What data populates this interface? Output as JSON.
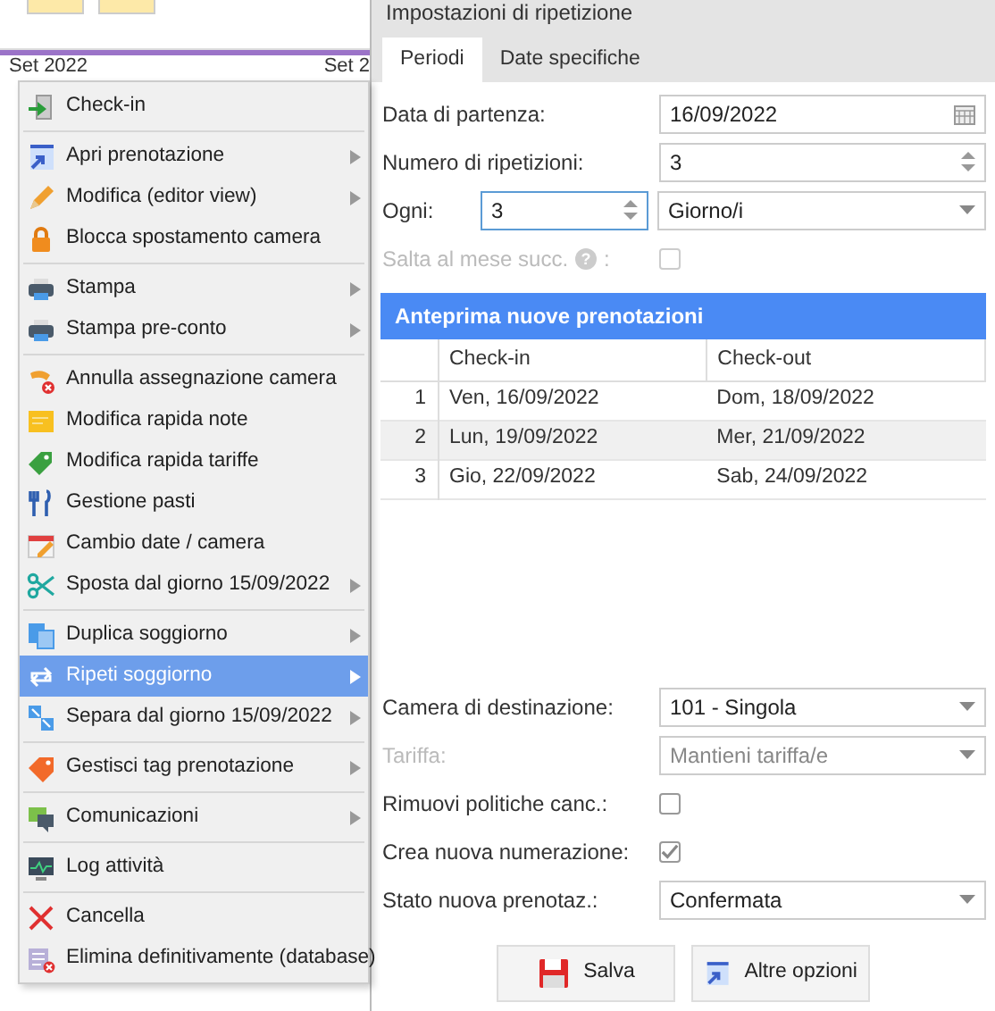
{
  "calendar": {
    "headers": [
      "Set 2022",
      "Set 2"
    ]
  },
  "menu": {
    "groups": [
      [
        {
          "label": "Check-in",
          "submenu": false,
          "selected": false
        }
      ],
      [
        {
          "label": "Apri prenotazione",
          "submenu": true,
          "selected": false
        },
        {
          "label": "Modifica (editor view)",
          "submenu": true,
          "selected": false
        },
        {
          "label": "Blocca spostamento camera",
          "submenu": false,
          "selected": false
        }
      ],
      [
        {
          "label": "Stampa",
          "submenu": true,
          "selected": false
        },
        {
          "label": "Stampa pre-conto",
          "submenu": true,
          "selected": false
        }
      ],
      [
        {
          "label": "Annulla assegnazione camera",
          "submenu": false,
          "selected": false
        },
        {
          "label": "Modifica rapida note",
          "submenu": false,
          "selected": false
        },
        {
          "label": "Modifica rapida tariffe",
          "submenu": false,
          "selected": false
        },
        {
          "label": "Gestione pasti",
          "submenu": false,
          "selected": false
        },
        {
          "label": "Cambio date / camera",
          "submenu": false,
          "selected": false
        },
        {
          "label": "Sposta dal giorno 15/09/2022",
          "submenu": true,
          "selected": false
        }
      ],
      [
        {
          "label": "Duplica soggiorno",
          "submenu": true,
          "selected": false
        },
        {
          "label": "Ripeti soggiorno",
          "submenu": true,
          "selected": true
        },
        {
          "label": "Separa dal giorno 15/09/2022",
          "submenu": true,
          "selected": false
        }
      ],
      [
        {
          "label": "Gestisci tag prenotazione",
          "submenu": true,
          "selected": false
        }
      ],
      [
        {
          "label": "Comunicazioni",
          "submenu": true,
          "selected": false
        }
      ],
      [
        {
          "label": "Log attività",
          "submenu": false,
          "selected": false
        }
      ],
      [
        {
          "label": "Cancella",
          "submenu": false,
          "selected": false
        },
        {
          "label": "Elimina definitivamente (database)",
          "submenu": false,
          "selected": false
        }
      ]
    ]
  },
  "dialog": {
    "title": "Impostazioni di ripetizione",
    "tabs": [
      {
        "label": "Periodi",
        "selected": true
      },
      {
        "label": "Date specifiche",
        "selected": false
      }
    ],
    "top_fields": [
      {
        "kind": "date",
        "label": "Data di partenza:",
        "value": "16/09/2022",
        "disabled": false
      },
      {
        "kind": "spinner",
        "label": "Numero di ripetizioni:",
        "value": "3",
        "disabled": false
      },
      {
        "kind": "spinner_select",
        "label": "Ogni:",
        "value": "3",
        "select_value": "Giorno/i",
        "focused": true,
        "disabled": false
      },
      {
        "kind": "checkbox",
        "label": "Salta al mese succ.",
        "suffix": ":",
        "help": "?",
        "checked": false,
        "disabled": true
      }
    ],
    "preview": {
      "title": "Anteprima nuove prenotazioni",
      "columns": [
        "Check-in",
        "Check-out"
      ],
      "rows": [
        {
          "index": "1",
          "cells": [
            "Ven, 16/09/2022",
            "Dom, 18/09/2022"
          ]
        },
        {
          "index": "2",
          "cells": [
            "Lun, 19/09/2022",
            "Mer, 21/09/2022"
          ]
        },
        {
          "index": "3",
          "cells": [
            "Gio, 22/09/2022",
            "Sab, 24/09/2022"
          ]
        }
      ]
    },
    "bottom_fields": [
      {
        "kind": "select",
        "label": "Camera di destinazione:",
        "value": "101 - Singola",
        "disabled": false
      },
      {
        "kind": "select",
        "label": "Tariffa:",
        "value": "Mantieni tariffa/e",
        "disabled": true
      },
      {
        "kind": "checkbox",
        "label": "Rimuovi politiche canc.:",
        "checked": false,
        "disabled": false
      },
      {
        "kind": "checkbox",
        "label": "Crea nuova numerazione:",
        "checked": true,
        "disabled": false
      },
      {
        "kind": "select",
        "label": "Stato nuova prenotaz.:",
        "value": "Confermata",
        "disabled": false
      }
    ],
    "buttons": [
      {
        "label": "Salva",
        "kind": "save"
      },
      {
        "label": "Altre opzioni",
        "kind": "more"
      }
    ]
  }
}
